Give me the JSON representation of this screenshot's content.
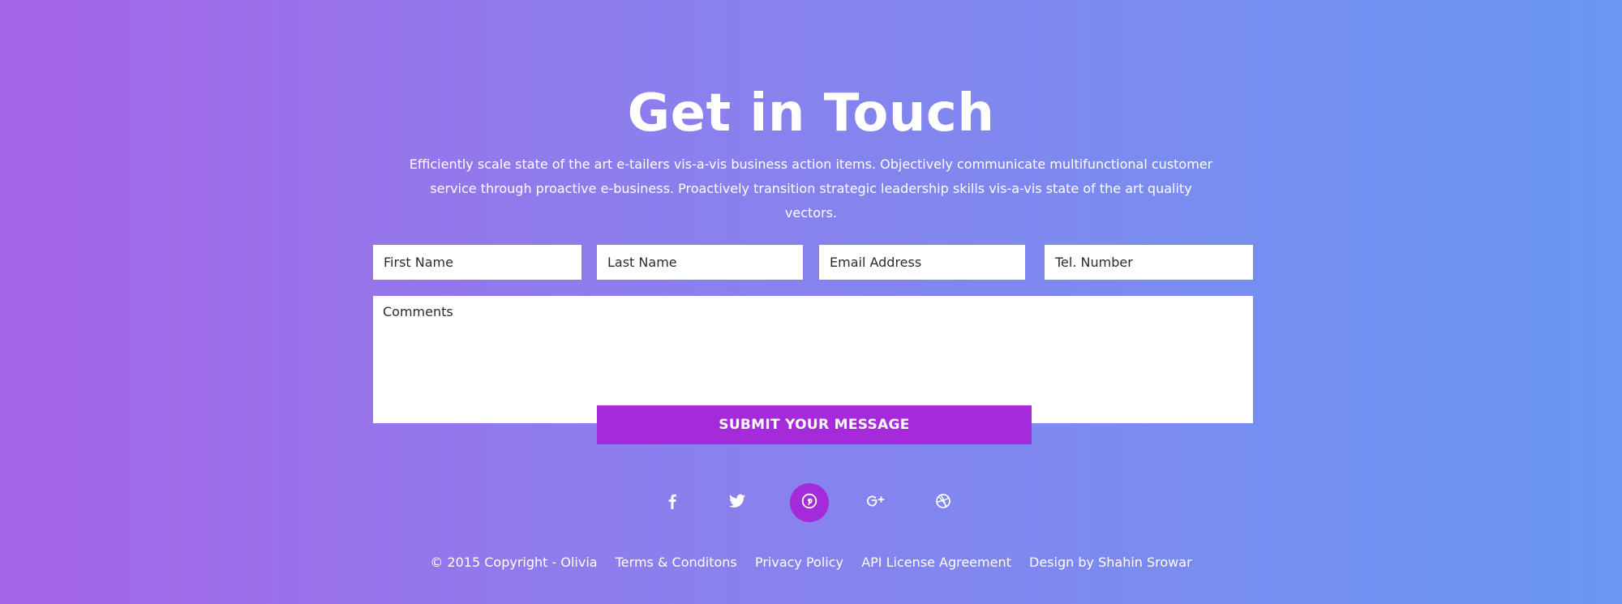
{
  "header": {
    "title": "Get in Touch",
    "intro_line1": "Efficiently scale state of the art e-tailers vis-a-vis business action items. Objectively communicate multifunctional customer",
    "intro_line2": "service through proactive e-business. Proactively transition strategic leadership skills vis-a-vis state of the art quality vectors."
  },
  "form": {
    "first_name_placeholder": "First Name",
    "last_name_placeholder": "Last Name",
    "email_placeholder": "Email Address",
    "tel_placeholder": "Tel. Number",
    "comments_placeholder": "Comments",
    "submit_label": "SUBMIT YOUR MESSAGE"
  },
  "social": {
    "items": [
      {
        "icon": "facebook-icon"
      },
      {
        "icon": "twitter-icon"
      },
      {
        "icon": "pinterest-icon",
        "active": true
      },
      {
        "icon": "google-plus-icon"
      },
      {
        "icon": "dribbble-icon"
      }
    ],
    "active_color": "#a52ad9"
  },
  "footer": {
    "copyright": "© 2015 Copyright - Olivia",
    "terms": "Terms & Conditons",
    "privacy": "Privacy Policy",
    "api": "API License Agreement",
    "design": "Design by Shahin Srowar"
  },
  "colors": {
    "gradient_start": "#a664e6",
    "gradient_end": "#6a98f3",
    "accent": "#a52ad9"
  }
}
